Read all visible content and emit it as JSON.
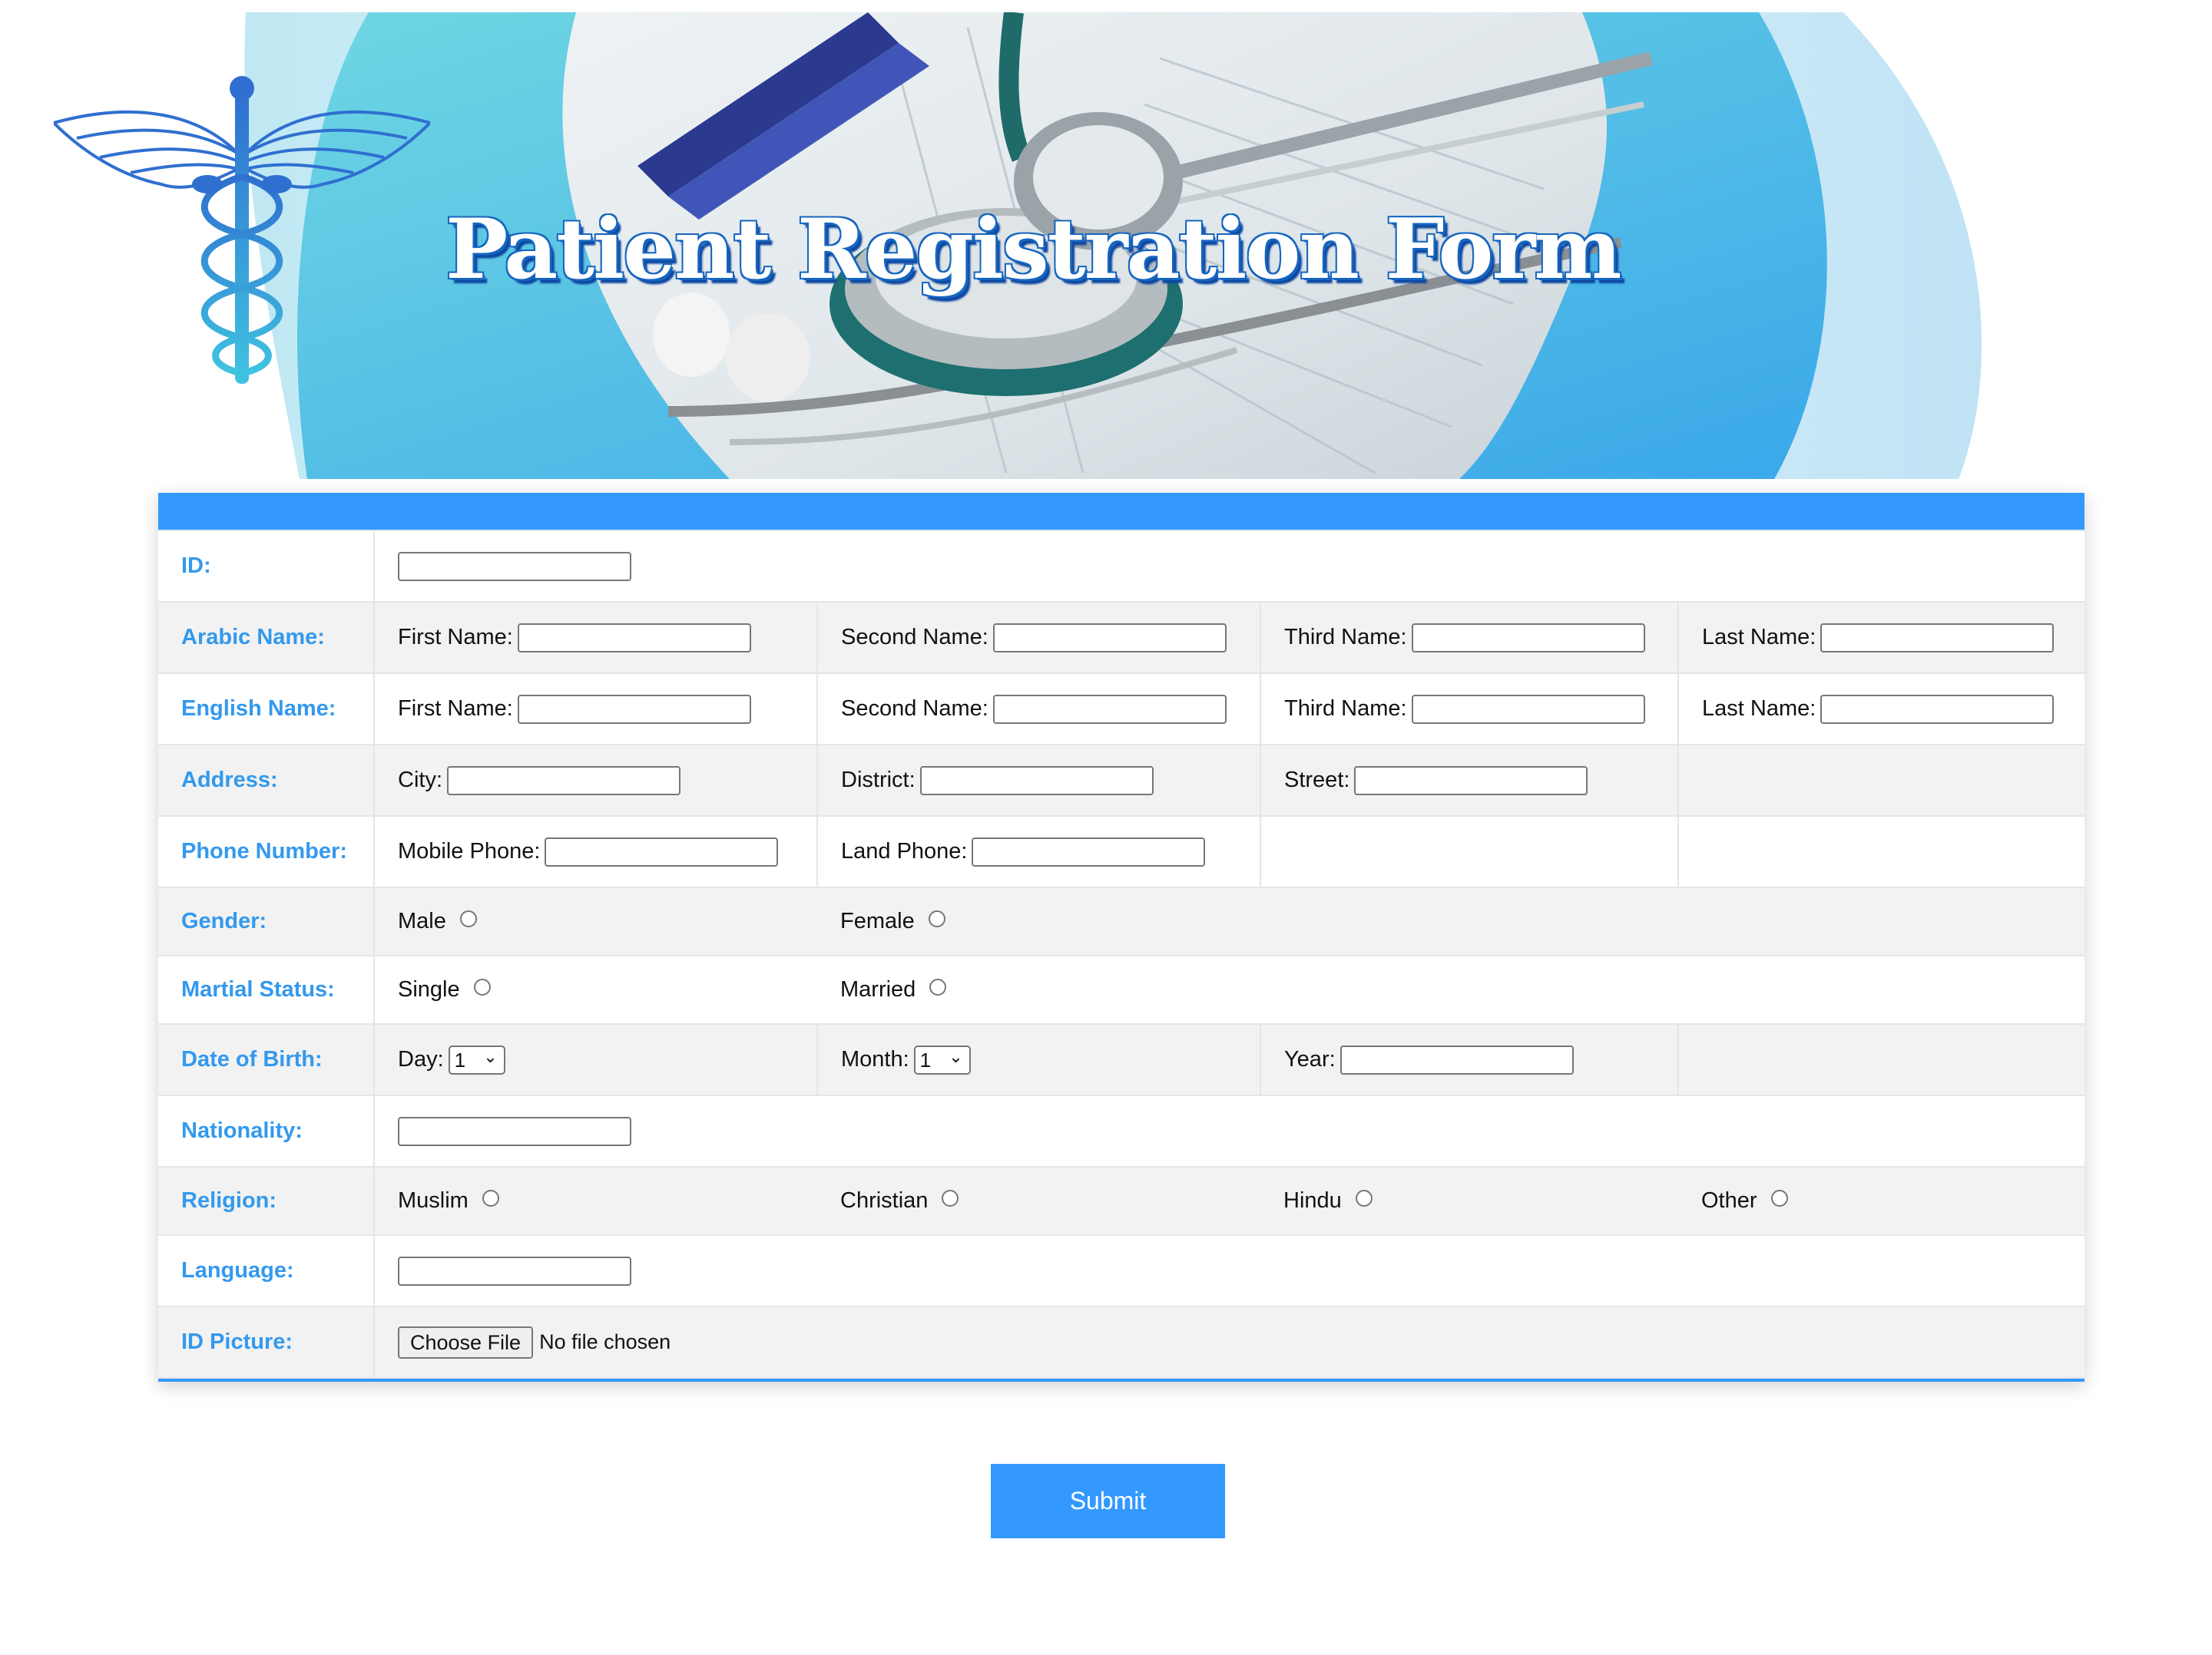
{
  "header": {
    "title": "Patient Registration Form"
  },
  "labels": {
    "id": "ID:",
    "arabic_name": "Arabic Name:",
    "english_name": "English Name:",
    "address": "Address:",
    "phone": "Phone Number:",
    "gender": "Gender:",
    "marital": "Martial Status:",
    "dob": "Date of Birth:",
    "nationality": "Nationality:",
    "religion": "Religion:",
    "language": "Language:",
    "id_picture": "ID Picture:"
  },
  "name_fields": {
    "first": "First Name:",
    "second": "Second Name:",
    "third": "Third Name:",
    "last": "Last Name:"
  },
  "address_fields": {
    "city": "City:",
    "district": "District:",
    "street": "Street:"
  },
  "phone_fields": {
    "mobile": "Mobile Phone:",
    "land": "Land Phone:"
  },
  "gender_options": {
    "male": "Male",
    "female": "Female"
  },
  "marital_options": {
    "single": "Single",
    "married": "Married"
  },
  "dob_fields": {
    "day": "Day:",
    "day_value": "1",
    "month": "Month:",
    "month_value": "1",
    "year": "Year:"
  },
  "religion_options": {
    "muslim": "Muslim",
    "christian": "Christian",
    "hindu": "Hindu",
    "other": "Other"
  },
  "file": {
    "button": "Choose File",
    "status": "No file chosen"
  },
  "submit": "Submit",
  "colors": {
    "accent": "#3399ff",
    "label": "#3399ee",
    "row_alt": "#f2f2f2"
  },
  "icons": {
    "logo": "caduceus-icon",
    "chevron": "chevron-down-icon"
  }
}
